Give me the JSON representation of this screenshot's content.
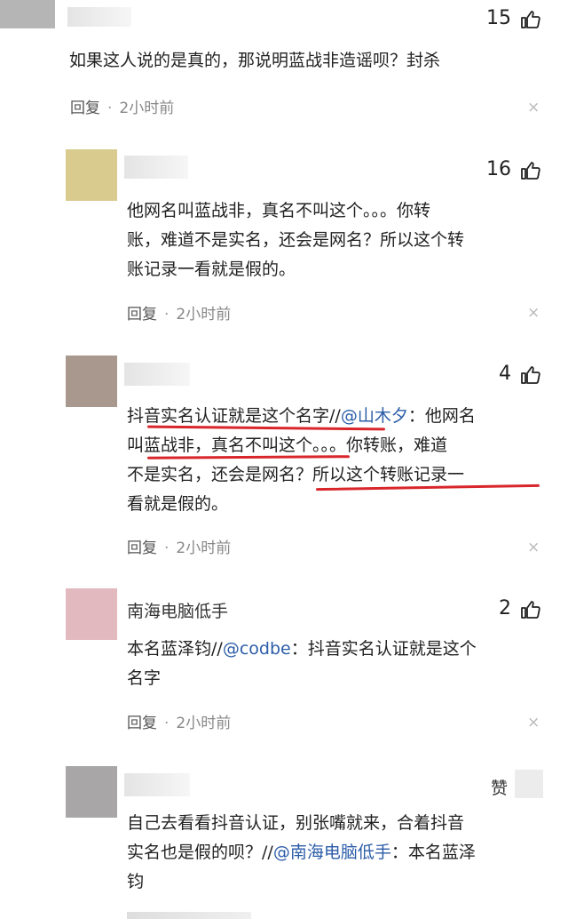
{
  "comments": [
    {
      "avatar_color": "#b5b5b5",
      "likes": "15",
      "lines": [
        "如果这人说的是真的，那说明蓝战非造谣呗？封杀"
      ],
      "reply": "回复",
      "dot": "·",
      "time": "2小时前",
      "close": "×"
    },
    {
      "avatar_color": "#d9cb8e",
      "likes": "16",
      "lines": [
        "他网名叫蓝战非，真名不叫这个。。。你转",
        "账，难道不是实名，还会是网名？所以这个转",
        "账记录一看就是假的。"
      ],
      "reply": "回复",
      "dot": "·",
      "time": "2小时前",
      "close": "×"
    },
    {
      "avatar_color": "#a8988d",
      "likes": "4",
      "line1_a": "抖音实名认证就是这个名字//",
      "line1_mention": "@山木夕",
      "line1_b": "：他网名",
      "line2": "叫蓝战非，真名不叫这个。。。你转账，难道",
      "line3": "不是实名，还会是网名？所以这个转账记录一",
      "line4": "看就是假的。",
      "reply": "回复",
      "dot": "·",
      "time": "2小时前",
      "close": "×"
    },
    {
      "avatar_color": "#e2b9bf",
      "name": "南海电脑低手",
      "likes": "2",
      "line1_a": "本名蓝泽钧//",
      "line1_mention": "@codbe",
      "line1_b": "：抖音实名认证就是这个",
      "line2": "名字",
      "reply": "回复",
      "dot": "·",
      "time": "2小时前",
      "close": "×"
    },
    {
      "avatar_color": "#a9a6a7",
      "like_label": "赞",
      "line1": "自己去看看抖音认证，别张嘴就来，合着抖音",
      "line2_a": "实名也是假的呗？//",
      "line2_mention": "@南海电脑低手",
      "line2_b": "：本名蓝泽",
      "line3": "钧"
    }
  ],
  "colors": {
    "mention": "#2c5da8",
    "underline": "#d8262b"
  }
}
